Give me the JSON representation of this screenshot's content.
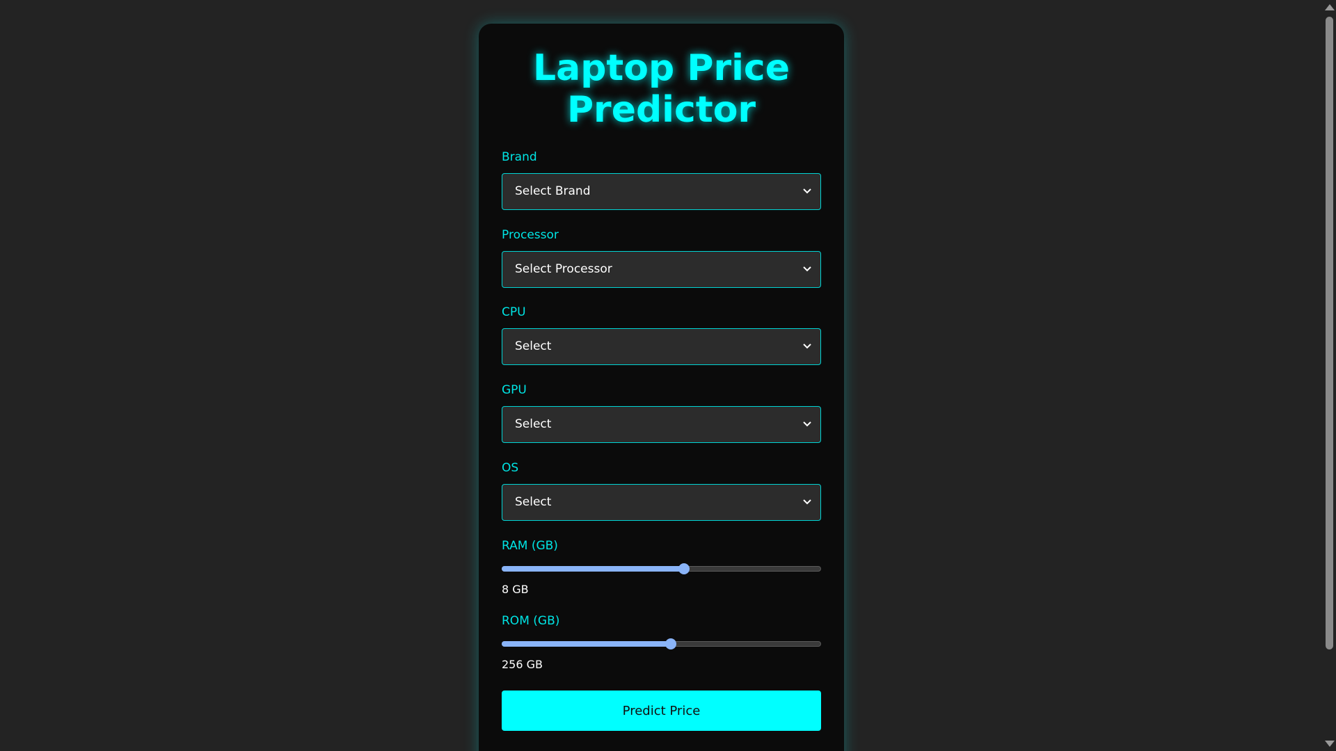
{
  "title": "Laptop Price Predictor",
  "form": {
    "brand": {
      "label": "Brand",
      "value": "Select Brand"
    },
    "processor": {
      "label": "Processor",
      "value": "Select Processor"
    },
    "cpu": {
      "label": "CPU",
      "value": "Select"
    },
    "gpu": {
      "label": "GPU",
      "value": "Select"
    },
    "os": {
      "label": "OS",
      "value": "Select"
    },
    "ram": {
      "label": "RAM (GB)",
      "display": "8 GB",
      "level": 0.57
    },
    "rom": {
      "label": "ROM (GB)",
      "display": "256 GB",
      "level": 0.53
    },
    "submit_label": "Predict Price"
  },
  "icons": {
    "select": "chevron-down-icon",
    "scroll_up": "triangle-up-icon",
    "scroll_down": "triangle-down-icon"
  },
  "colors": {
    "accent": "#00ffff",
    "background": "#232323",
    "card": "#0b0b0b",
    "field_bg": "#2c2c2c",
    "slider": "#8ab4f8"
  }
}
